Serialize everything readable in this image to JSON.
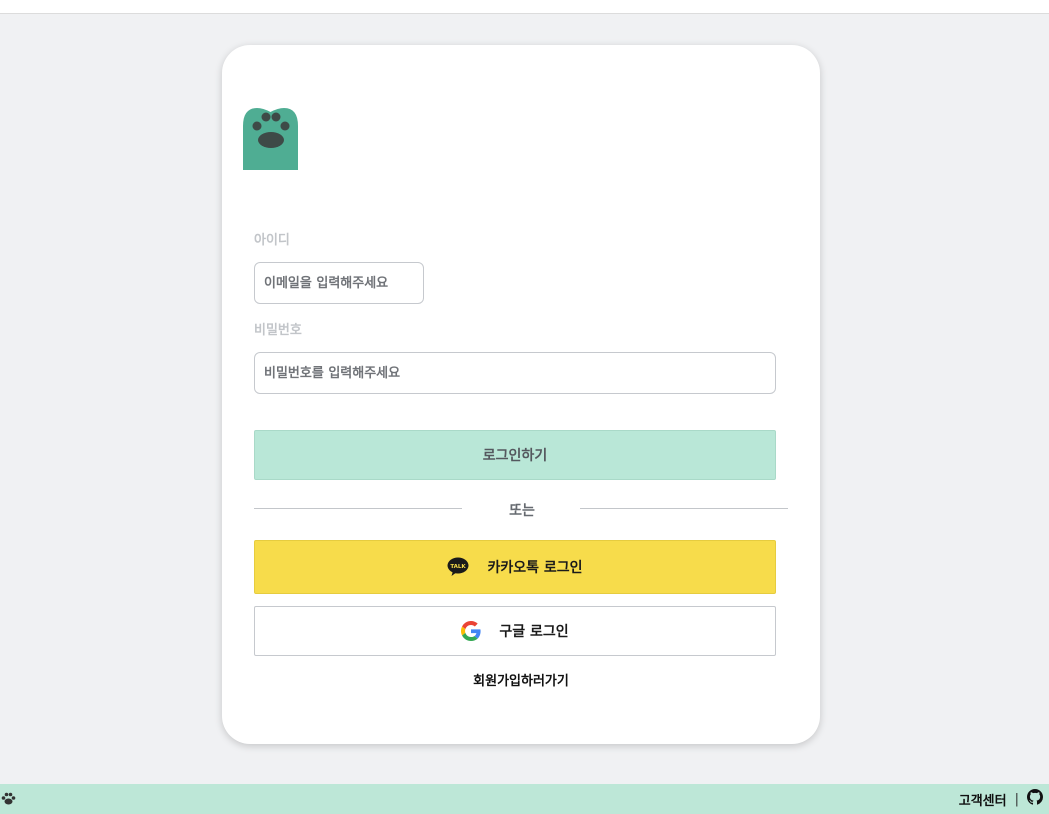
{
  "colors": {
    "accent": "#b9e7d7",
    "footer": "#bde7d7",
    "kakao": "#f7dc4b",
    "logo": "#4fad93"
  },
  "logo": {
    "icon": "paw-icon"
  },
  "form": {
    "id_label": "아이디",
    "id_placeholder": "이메일을 입력해주세요",
    "pw_label": "비밀번호",
    "pw_placeholder": "비밀번호를 입력해주세요",
    "login_label": "로그인하기"
  },
  "divider": {
    "text": "또는"
  },
  "social": {
    "kakao_label": "카카오톡 로그인",
    "kakao_icon_text": "TALK",
    "google_label": "구글 로그인"
  },
  "signup_label": "회원가입하러가기",
  "footer": {
    "customer_center": "고객센터",
    "separator": "|",
    "github_icon": "github-icon"
  }
}
